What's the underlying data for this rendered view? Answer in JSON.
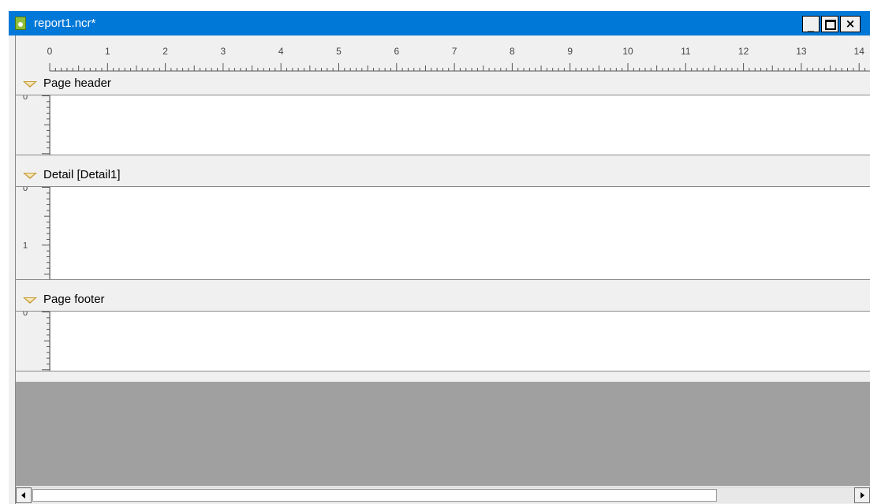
{
  "window": {
    "title": "report1.ncr*",
    "icon": "report-file-icon",
    "controls": {
      "minimize": "_",
      "close": "×"
    }
  },
  "ruler": {
    "labels": [
      "0",
      "1",
      "2",
      "3",
      "4",
      "5",
      "6",
      "7",
      "8",
      "9",
      "10",
      "11",
      "12",
      "13",
      "14"
    ]
  },
  "bands": [
    {
      "label": "Page header",
      "vruler_labels": [
        "0"
      ]
    },
    {
      "label": "Detail [Detail1]",
      "vruler_labels": [
        "0",
        "1"
      ]
    },
    {
      "label": "Page footer",
      "vruler_labels": [
        "0"
      ]
    }
  ],
  "colors": {
    "titlebar": "#0078d7",
    "band_marker": "#c89a3c",
    "workspace_grey": "#a0a0a0"
  },
  "scrollbar": {
    "arrow_left": "left-arrow-icon",
    "arrow_right": "right-arrow-icon"
  }
}
